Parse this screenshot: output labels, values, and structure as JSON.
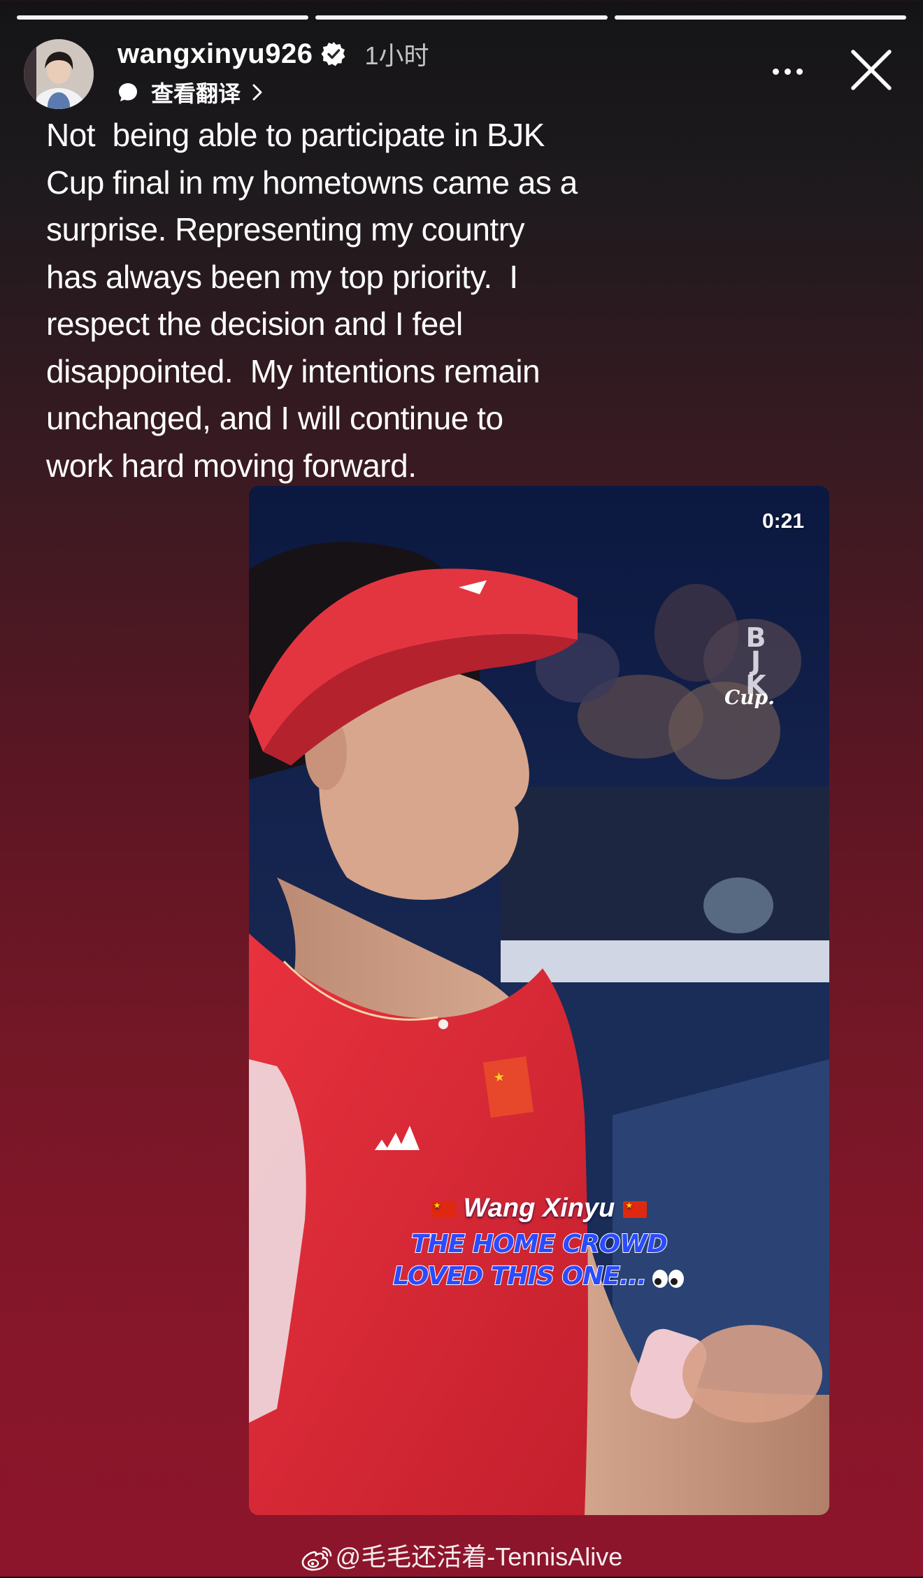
{
  "story": {
    "progress": {
      "segments": 3,
      "active_index": 2
    },
    "header": {
      "username": "wangxinyu926",
      "verified": true,
      "timestamp": "1小时",
      "translate_label": "查看翻译"
    },
    "caption": "Not  being able to participate in BJK\nCup final in my hometowns came as a\nsurprise. Representing my country\nhas always been my top priority.  I\nrespect the decision and I feel\ndisappointed.  My intentions remain\nunchanged, and I will continue to\nwork hard moving forward.",
    "video": {
      "time": "0:21",
      "logo_letters": [
        "B",
        "J",
        "K"
      ],
      "logo_script": "Cup.",
      "overlay_name": "Wang Xinyu",
      "overlay_line1": "THE HOME CROWD",
      "overlay_line2": "LOVED THIS ONE...",
      "overlay_emoji": "eyes-icon"
    },
    "watermark": "@毛毛还活着-TennisAlive"
  },
  "colors": {
    "background_top": "#141416",
    "background_bottom": "#8d152b",
    "overlay_text_fill": "#2a4bff",
    "flag_red": "#de2910",
    "flag_star": "#ffde00"
  }
}
